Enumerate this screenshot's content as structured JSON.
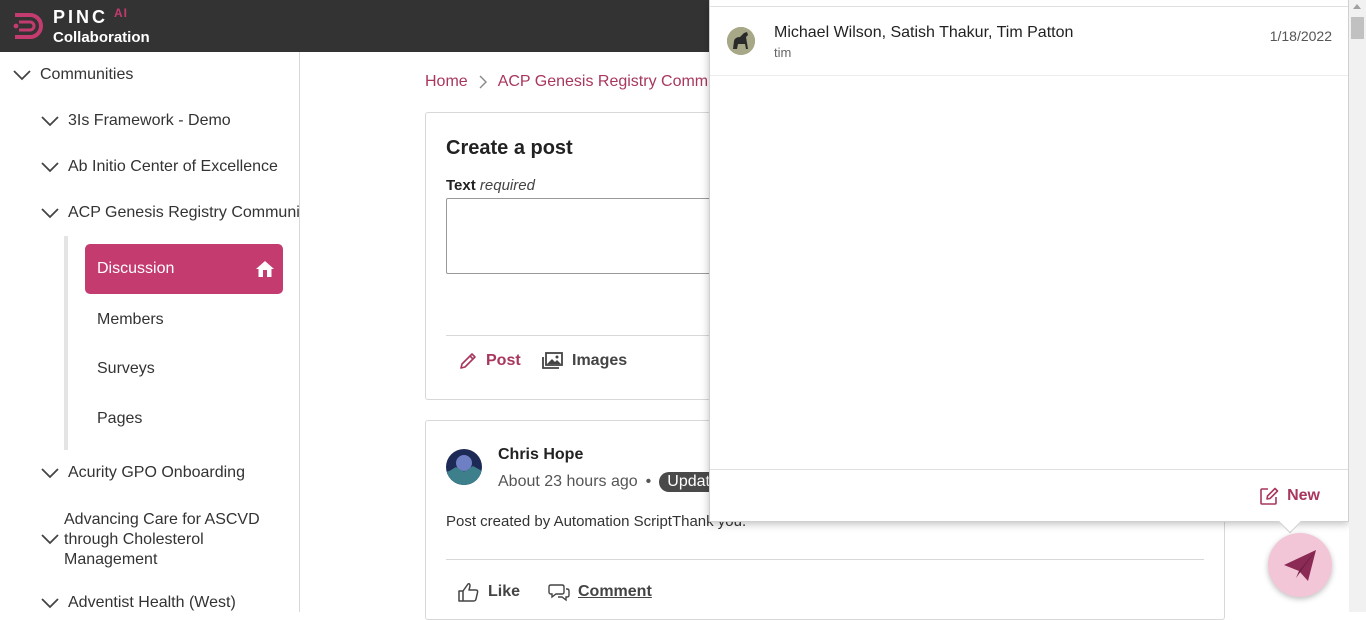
{
  "header": {
    "brand": "PINC",
    "brand_ai": "AI",
    "subtitle": "Collaboration",
    "bg_color": "#333333",
    "accent": "#c33b6f"
  },
  "sidebar": {
    "root": "Communities",
    "items": [
      "3Is Framework - Demo",
      "Ab Initio Center of Excellence",
      "ACP Genesis Registry Community"
    ],
    "subnav": {
      "active": "Discussion",
      "items": [
        "Members",
        "Surveys",
        "Pages"
      ]
    },
    "more_items": [
      "Acurity GPO Onboarding",
      "Advancing Care for ASCVD through Cholesterol Management",
      "Adventist Health (West)"
    ]
  },
  "breadcrumb": {
    "home": "Home",
    "current": "ACP Genesis Registry Community"
  },
  "create_post": {
    "title": "Create a post",
    "text_label": "Text",
    "text_required": "required",
    "post_label": "Post",
    "images_label": "Images"
  },
  "post": {
    "author": "Chris Hope",
    "time": "About 23 hours ago",
    "separator": "•",
    "badge": "Updated",
    "body": "Post created by Automation ScriptThank you.",
    "like_label": "Like",
    "comment_label": "Comment"
  },
  "messages": {
    "conversations": [
      {
        "names": "Michael Wilson, Satish Thakur, Tim Patton",
        "preview": "tim",
        "date": "1/18/2022"
      }
    ],
    "new_label": "New"
  }
}
